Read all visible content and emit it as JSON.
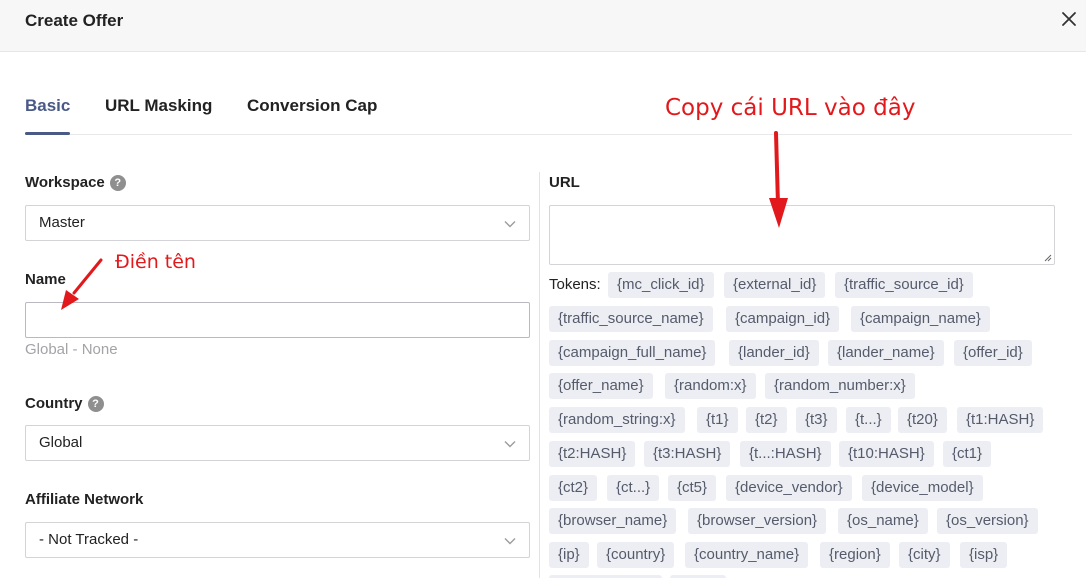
{
  "dialog": {
    "title": "Create Offer",
    "close_icon": "close-icon"
  },
  "tabs": [
    {
      "label": "Basic",
      "active": true
    },
    {
      "label": "URL Masking",
      "active": false
    },
    {
      "label": "Conversion Cap",
      "active": false
    }
  ],
  "form": {
    "workspace": {
      "label": "Workspace",
      "help": "?",
      "value": "Master"
    },
    "name": {
      "label": "Name",
      "value": "",
      "hint": "Global - None"
    },
    "country": {
      "label": "Country",
      "help": "?",
      "value": "Global"
    },
    "affiliate_network": {
      "label": "Affiliate Network",
      "value": "- Not Tracked -"
    }
  },
  "url": {
    "label": "URL",
    "value": "",
    "tokens_label": "Tokens:",
    "tokens": [
      "{mc_click_id}",
      "{external_id}",
      "{traffic_source_id}",
      "{traffic_source_name}",
      "{campaign_id}",
      "{campaign_name}",
      "{campaign_full_name}",
      "{lander_id}",
      "{lander_name}",
      "{offer_id}",
      "{offer_name}",
      "{random:x}",
      "{random_number:x}",
      "{random_string:x}",
      "{t1}",
      "{t2}",
      "{t3}",
      "{t...}",
      "{t20}",
      "{t1:HASH}",
      "{t2:HASH}",
      "{t3:HASH}",
      "{t...:HASH}",
      "{t10:HASH}",
      "{ct1}",
      "{ct2}",
      "{ct...}",
      "{ct5}",
      "{device_vendor}",
      "{device_model}",
      "{browser_name}",
      "{browser_version}",
      "{os_name}",
      "{os_version}",
      "{ip}",
      "{country}",
      "{country_name}",
      "{region}",
      "{city}",
      "{isp}"
    ]
  },
  "annotations": {
    "copy_url": "Copy cái URL vào đây",
    "fill_name": "Điền tên"
  },
  "colors": {
    "accent": "#4a5a86",
    "annotation": "#e2191c",
    "token_bg": "#eceef3"
  }
}
